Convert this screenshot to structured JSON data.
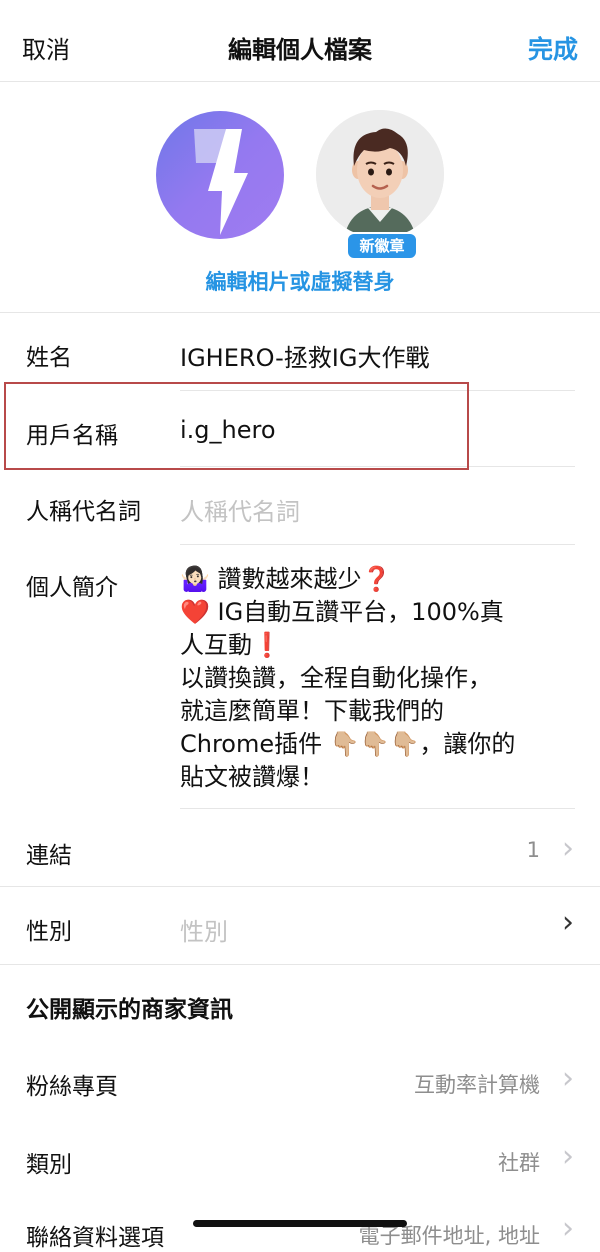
{
  "header": {
    "cancel_label": "取消",
    "title": "編輯個人檔案",
    "done_label": "完成"
  },
  "profile": {
    "new_badge": "新徽章",
    "edit_photo_label": "編輯相片或虛擬替身"
  },
  "fields": {
    "name": {
      "label": "姓名",
      "value": "IGHERO-拯救IG大作戰"
    },
    "username": {
      "label": "用戶名稱",
      "value": "i.g_hero"
    },
    "pronouns": {
      "label": "人稱代名詞",
      "placeholder": "人稱代名詞"
    },
    "bio": {
      "label": "個人簡介",
      "lines": [
        "🤷🏻‍♀️ 讚數越來越少❓",
        "❤️ IG自動互讚平台，100%真",
        "人互動❗",
        "以讚換讚，全程自動化操作，",
        "就這麼簡單！下載我們的",
        "Chrome插件 👇🏼👇🏼👇🏼，讓你的",
        "貼文被讚爆！"
      ]
    },
    "links": {
      "label": "連結",
      "count": "1"
    },
    "gender": {
      "label": "性別",
      "placeholder": "性別"
    }
  },
  "business": {
    "section_title": "公開顯示的商家資訊",
    "page": {
      "label": "粉絲專頁",
      "value": "互動率計算機"
    },
    "category": {
      "label": "類別",
      "value": "社群"
    },
    "contact": {
      "label": "聯絡資料選項",
      "value": "電子郵件地址, 地址"
    }
  },
  "colors": {
    "accent": "#2694e3",
    "highlight_border": "#b84a4a"
  },
  "icons": {
    "chevron": "chevron-right-icon"
  }
}
